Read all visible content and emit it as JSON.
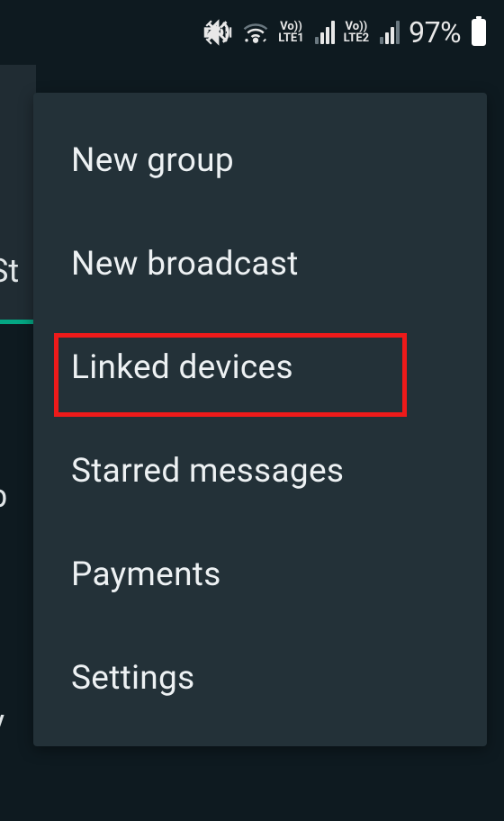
{
  "status_bar": {
    "battery_percent": "97%",
    "lte1_label": "LTE1",
    "lte2_label": "LTE2",
    "vo_label": "Vo))"
  },
  "background": {
    "tab_fragment_1": "St",
    "text_fragment_2": "b",
    "text_fragment_3": "y"
  },
  "menu": {
    "items": [
      {
        "label": "New group"
      },
      {
        "label": "New broadcast"
      },
      {
        "label": "Linked devices"
      },
      {
        "label": "Starred messages"
      },
      {
        "label": "Payments"
      },
      {
        "label": "Settings"
      }
    ]
  }
}
